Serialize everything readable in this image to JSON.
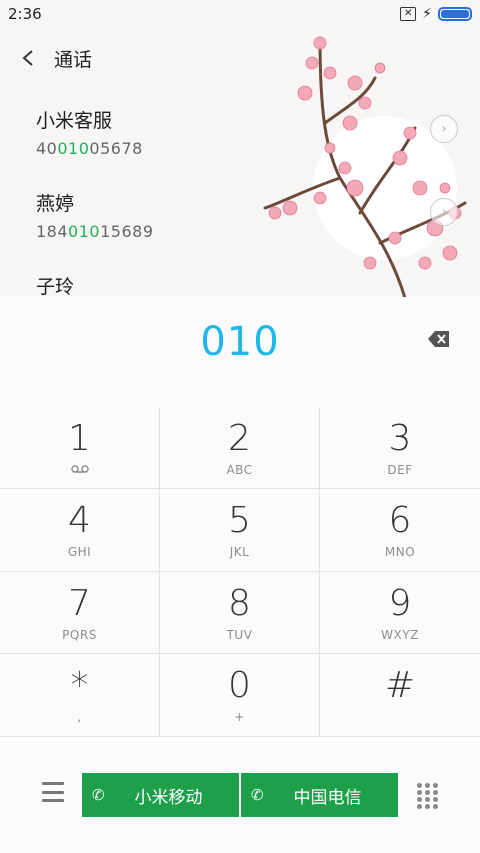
{
  "status": {
    "time": "2:36",
    "sim_icon": "sim-card-off-icon",
    "charging_icon": "bolt-icon",
    "battery_color": "#2b6fde"
  },
  "header": {
    "title": "通话"
  },
  "results": [
    {
      "name": "小米客服",
      "number_pre": "40",
      "number_match": "010",
      "number_post": "05678"
    },
    {
      "name": "燕婷",
      "number_pre": "184",
      "number_match": "010",
      "number_post": "15689"
    },
    {
      "name": "子玲",
      "number_pre": "",
      "number_match": "",
      "number_post": ""
    }
  ],
  "dialer": {
    "input": "010",
    "accent": "#1fb7ea",
    "match_color": "#22b05a"
  },
  "keys": [
    {
      "digit": "1",
      "letters": ""
    },
    {
      "digit": "2",
      "letters": "ABC"
    },
    {
      "digit": "3",
      "letters": "DEF"
    },
    {
      "digit": "4",
      "letters": "GHI"
    },
    {
      "digit": "5",
      "letters": "JKL"
    },
    {
      "digit": "6",
      "letters": "MNO"
    },
    {
      "digit": "7",
      "letters": "PQRS"
    },
    {
      "digit": "8",
      "letters": "TUV"
    },
    {
      "digit": "9",
      "letters": "WXYZ"
    },
    {
      "digit": "*",
      "letters": ","
    },
    {
      "digit": "0",
      "letters": "+"
    },
    {
      "digit": "#",
      "letters": ""
    }
  ],
  "bottom": {
    "call1": "小米移动",
    "call2": "中国电信",
    "call_color": "#1e9f4a"
  }
}
